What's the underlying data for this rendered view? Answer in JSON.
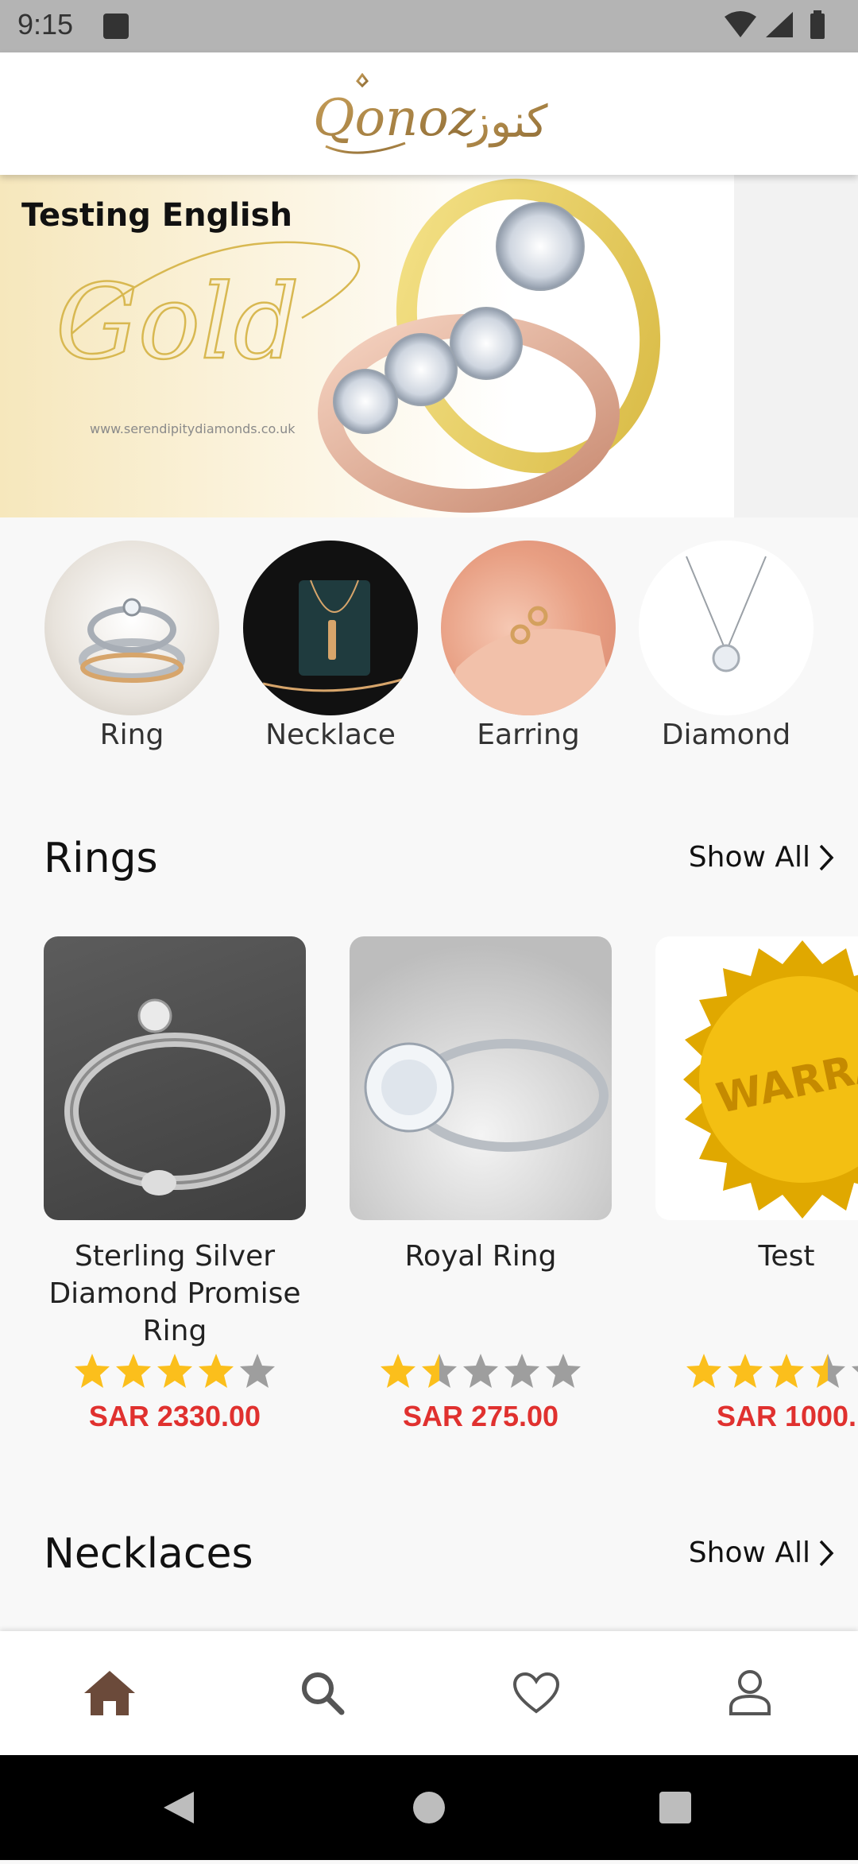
{
  "status_bar": {
    "time": "9:15"
  },
  "header": {
    "logo_latin": "Qonoz",
    "logo_arabic": "كنوز"
  },
  "banner": {
    "title": "Testing English",
    "script_text": "Gold",
    "url_text": "www.serendipitydiamonds.co.uk"
  },
  "categories": [
    {
      "label": "Ring"
    },
    {
      "label": "Necklace"
    },
    {
      "label": "Earring"
    },
    {
      "label": "Diamond"
    }
  ],
  "sections": {
    "rings": {
      "title": "Rings",
      "show_all": "Show All"
    },
    "necklaces": {
      "title": "Necklaces",
      "show_all": "Show All"
    }
  },
  "products": [
    {
      "name": "Sterling Silver Diamond Promise Ring",
      "price": "SAR 2330.00",
      "rating": 4
    },
    {
      "name": "Royal Ring",
      "price": "SAR 275.00",
      "rating": 1.5
    },
    {
      "name": "Test",
      "price": "SAR 1000.",
      "badge_text": "WARRANTY",
      "rating": 3.5
    }
  ],
  "colors": {
    "price": "#e0312f",
    "star": "#fbbf1c",
    "star_empty": "#9e9e9e",
    "nav_active": "#6b4a3a"
  },
  "bottom_nav": [
    {
      "icon": "home-icon",
      "active": true
    },
    {
      "icon": "search-icon",
      "active": false
    },
    {
      "icon": "heart-icon",
      "active": false
    },
    {
      "icon": "profile-icon",
      "active": false
    }
  ]
}
